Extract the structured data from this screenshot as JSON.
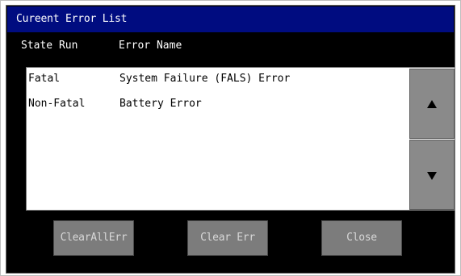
{
  "title": "Cureent Error List",
  "columns": {
    "state": "State Run",
    "name": "Error Name"
  },
  "errors": [
    {
      "state": "Fatal",
      "name": "System Failure (FALS) Error"
    },
    {
      "state": "Non-Fatal",
      "name": "Battery Error"
    }
  ],
  "scroll": {
    "up_icon": "triangle-up-icon",
    "down_icon": "triangle-down-icon"
  },
  "buttons": {
    "clear_all": "ClearAllErr",
    "clear": "Clear Err",
    "close": "Close"
  },
  "colors": {
    "title_bar": "#000c80",
    "background": "#000000",
    "list_bg": "#ffffff",
    "button_bg": "#7c7c7c",
    "button_text": "#d8d8d8"
  }
}
